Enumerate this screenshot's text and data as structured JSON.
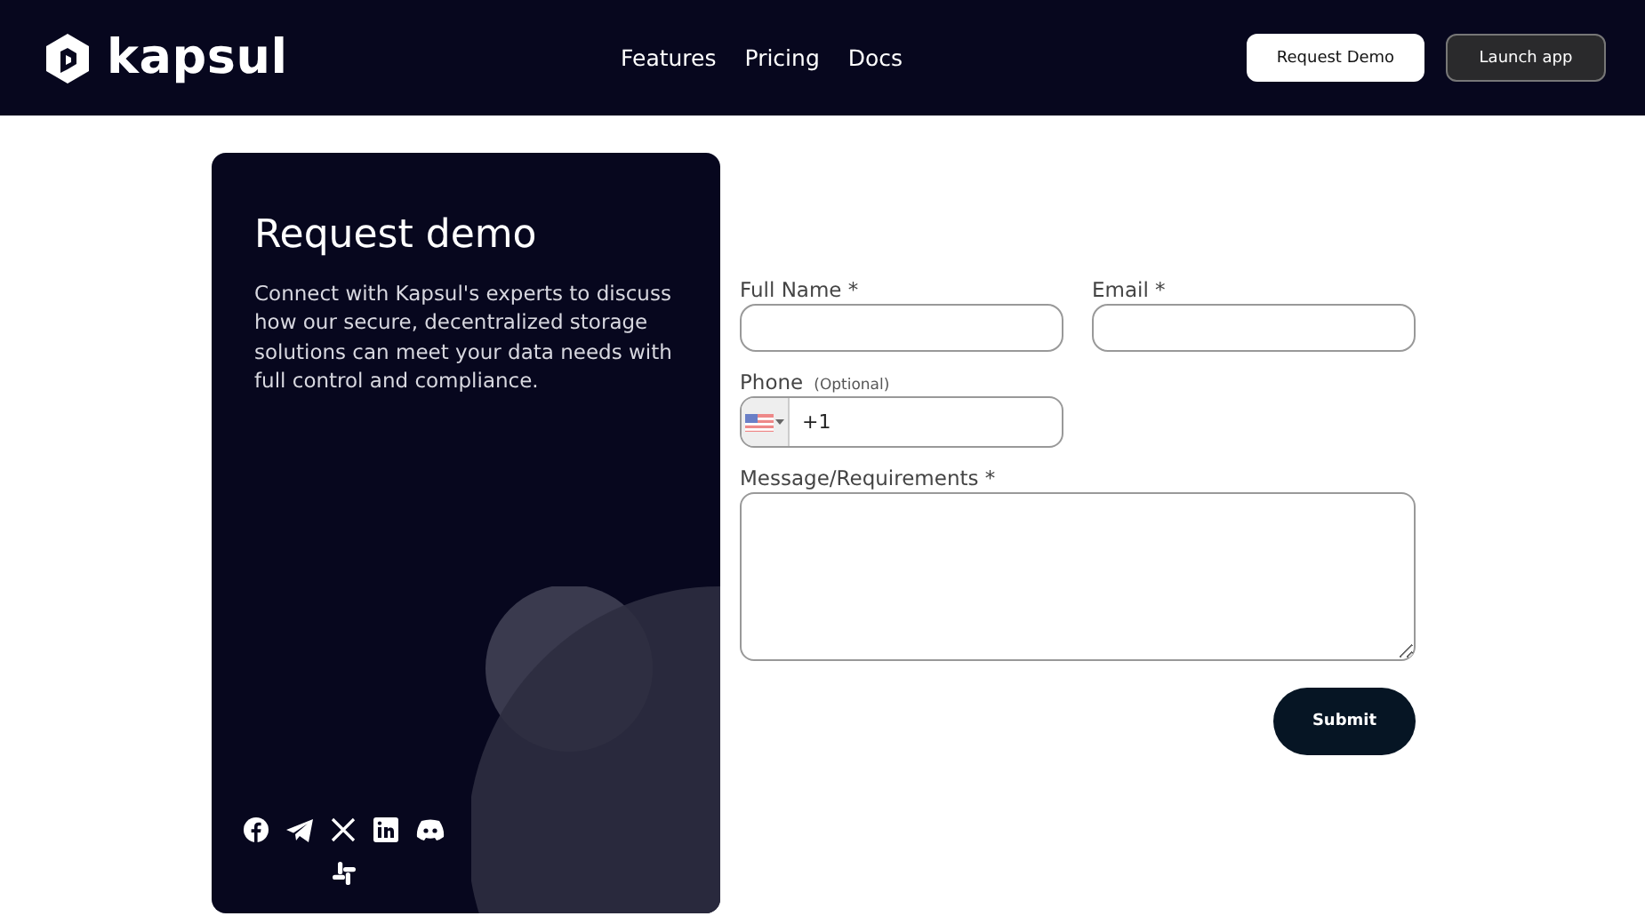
{
  "header": {
    "logo": "kapsul",
    "nav": [
      "Features",
      "Pricing",
      "Docs"
    ],
    "buttons": [
      {
        "label": "Request Demo",
        "kind": "primary"
      },
      {
        "label": "Launch app",
        "kind": "secondary"
      }
    ]
  },
  "intro": {
    "title": "Request demo",
    "text": "Connect with Kapsul's experts to discuss how our secure, decentralized storage solutions can meet your data needs with full control and compliance."
  },
  "form": {
    "full_name": {
      "label": "Full Name *"
    },
    "email": {
      "label": "Email *"
    },
    "phone": {
      "label": "Phone",
      "hint": "(Optional)",
      "value": "+1"
    },
    "message": {
      "label": "Message/Requirements *"
    },
    "submit": "Submit"
  }
}
